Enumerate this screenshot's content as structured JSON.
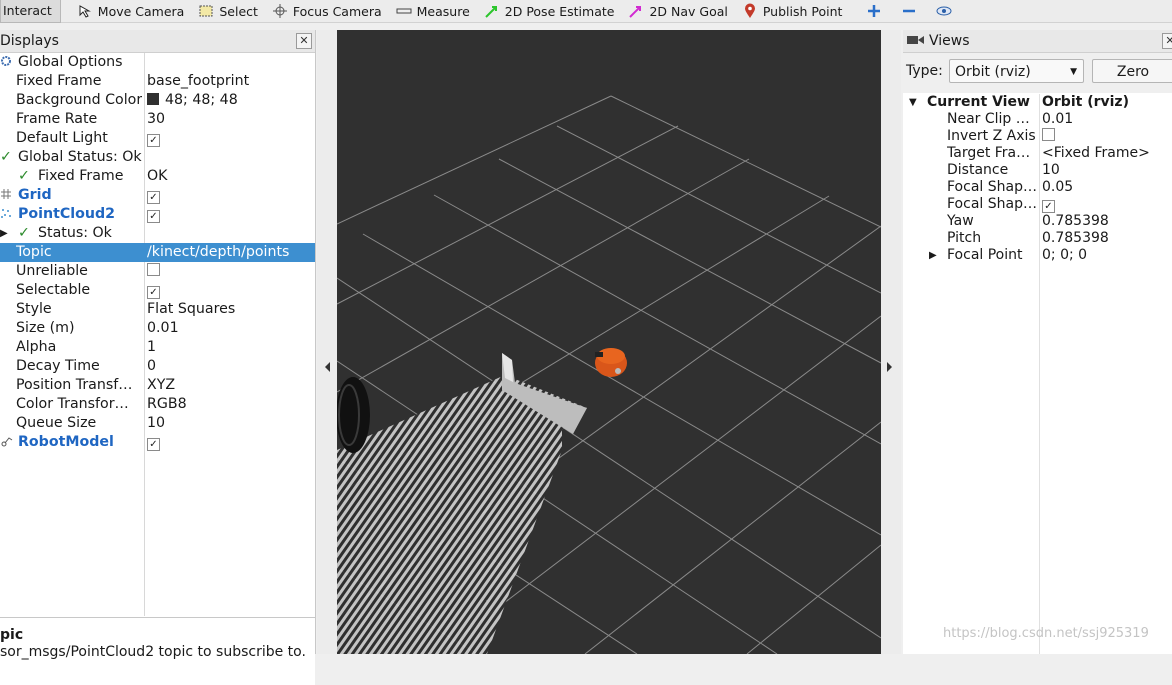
{
  "toolbar": {
    "items": [
      {
        "label": "Interact",
        "icon": "interact-icon"
      },
      {
        "label": "Move Camera",
        "icon": "move-camera-icon"
      },
      {
        "label": "Select",
        "icon": "select-icon"
      },
      {
        "label": "Focus Camera",
        "icon": "focus-camera-icon"
      },
      {
        "label": "Measure",
        "icon": "measure-icon"
      },
      {
        "label": "2D Pose Estimate",
        "icon": "pose-estimate-icon"
      },
      {
        "label": "2D Nav Goal",
        "icon": "nav-goal-icon"
      },
      {
        "label": "Publish Point",
        "icon": "publish-point-icon"
      }
    ]
  },
  "displays": {
    "title": "Displays",
    "rows": [
      {
        "name": "Global Options",
        "value": ""
      },
      {
        "name": "Fixed Frame",
        "value": "base_footprint"
      },
      {
        "name": "Background Color",
        "value": "48; 48; 48"
      },
      {
        "name": "Frame Rate",
        "value": "30"
      },
      {
        "name": "Default Light",
        "value": ""
      },
      {
        "name": "Global Status: Ok",
        "value": ""
      },
      {
        "name": "Fixed Frame",
        "value": "OK"
      },
      {
        "name": "Grid",
        "value": ""
      },
      {
        "name": "PointCloud2",
        "value": ""
      },
      {
        "name": "Status: Ok",
        "value": ""
      },
      {
        "name": "Topic",
        "value": "/kinect/depth/points"
      },
      {
        "name": "Unreliable",
        "value": ""
      },
      {
        "name": "Selectable",
        "value": ""
      },
      {
        "name": "Style",
        "value": "Flat Squares"
      },
      {
        "name": "Size (m)",
        "value": "0.01"
      },
      {
        "name": "Alpha",
        "value": "1"
      },
      {
        "name": "Decay Time",
        "value": "0"
      },
      {
        "name": "Position Transf…",
        "value": "XYZ"
      },
      {
        "name": "Color Transfor…",
        "value": "RGB8"
      },
      {
        "name": "Queue Size",
        "value": "10"
      },
      {
        "name": "RobotModel",
        "value": ""
      }
    ],
    "description_title": "pic",
    "description_text": "sor_msgs/PointCloud2 topic to subscribe to."
  },
  "views": {
    "title": "Views",
    "type_label": "Type:",
    "type_value": "Orbit (rviz)",
    "zero_label": "Zero",
    "rows": [
      {
        "name": "Current View",
        "value": "Orbit (rviz)"
      },
      {
        "name": "Near Clip …",
        "value": "0.01"
      },
      {
        "name": "Invert Z Axis",
        "value": ""
      },
      {
        "name": "Target Fra…",
        "value": "<Fixed Frame>"
      },
      {
        "name": "Distance",
        "value": "10"
      },
      {
        "name": "Focal Shap…",
        "value": "0.05"
      },
      {
        "name": "Focal Shap…",
        "value": ""
      },
      {
        "name": "Yaw",
        "value": "0.785398"
      },
      {
        "name": "Pitch",
        "value": "0.785398"
      },
      {
        "name": "Focal Point",
        "value": "0; 0; 0"
      }
    ]
  },
  "watermark": "https://blog.csdn.net/ssj925319",
  "colors": {
    "background": "#303030",
    "selection": "#3d8fd0",
    "accent_blue": "#1f66c2",
    "robot": "#d9561a"
  }
}
